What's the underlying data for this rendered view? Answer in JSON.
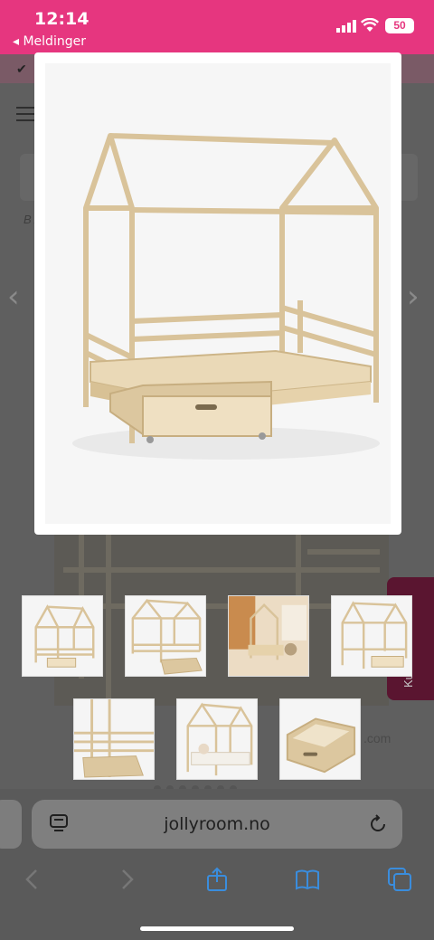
{
  "status_bar": {
    "time": "12:14",
    "back_label": "◂ Meldinger",
    "battery": "50",
    "bg_color": "#e6367f"
  },
  "page": {
    "side_tab": "Kundeservice",
    "domain_fragment": ".com",
    "crumb": "B /",
    "prev_arrow": "‹",
    "next_arrow": "›"
  },
  "modal": {
    "image": "house-bed-with-drawer"
  },
  "thumbnails": [
    {
      "name": "bed-front-view"
    },
    {
      "name": "bed-with-drawer-open"
    },
    {
      "name": "bed-in-room"
    },
    {
      "name": "bed-side-drawer"
    },
    {
      "name": "bed-drawer-closeup"
    },
    {
      "name": "bed-with-bedding"
    },
    {
      "name": "drawer-only"
    }
  ],
  "browser": {
    "url": "jollyroom.no",
    "icons": [
      "reader-icon",
      "reload-icon",
      "back-icon",
      "forward-icon",
      "share-icon",
      "bookmarks-icon",
      "tabs-icon"
    ]
  }
}
